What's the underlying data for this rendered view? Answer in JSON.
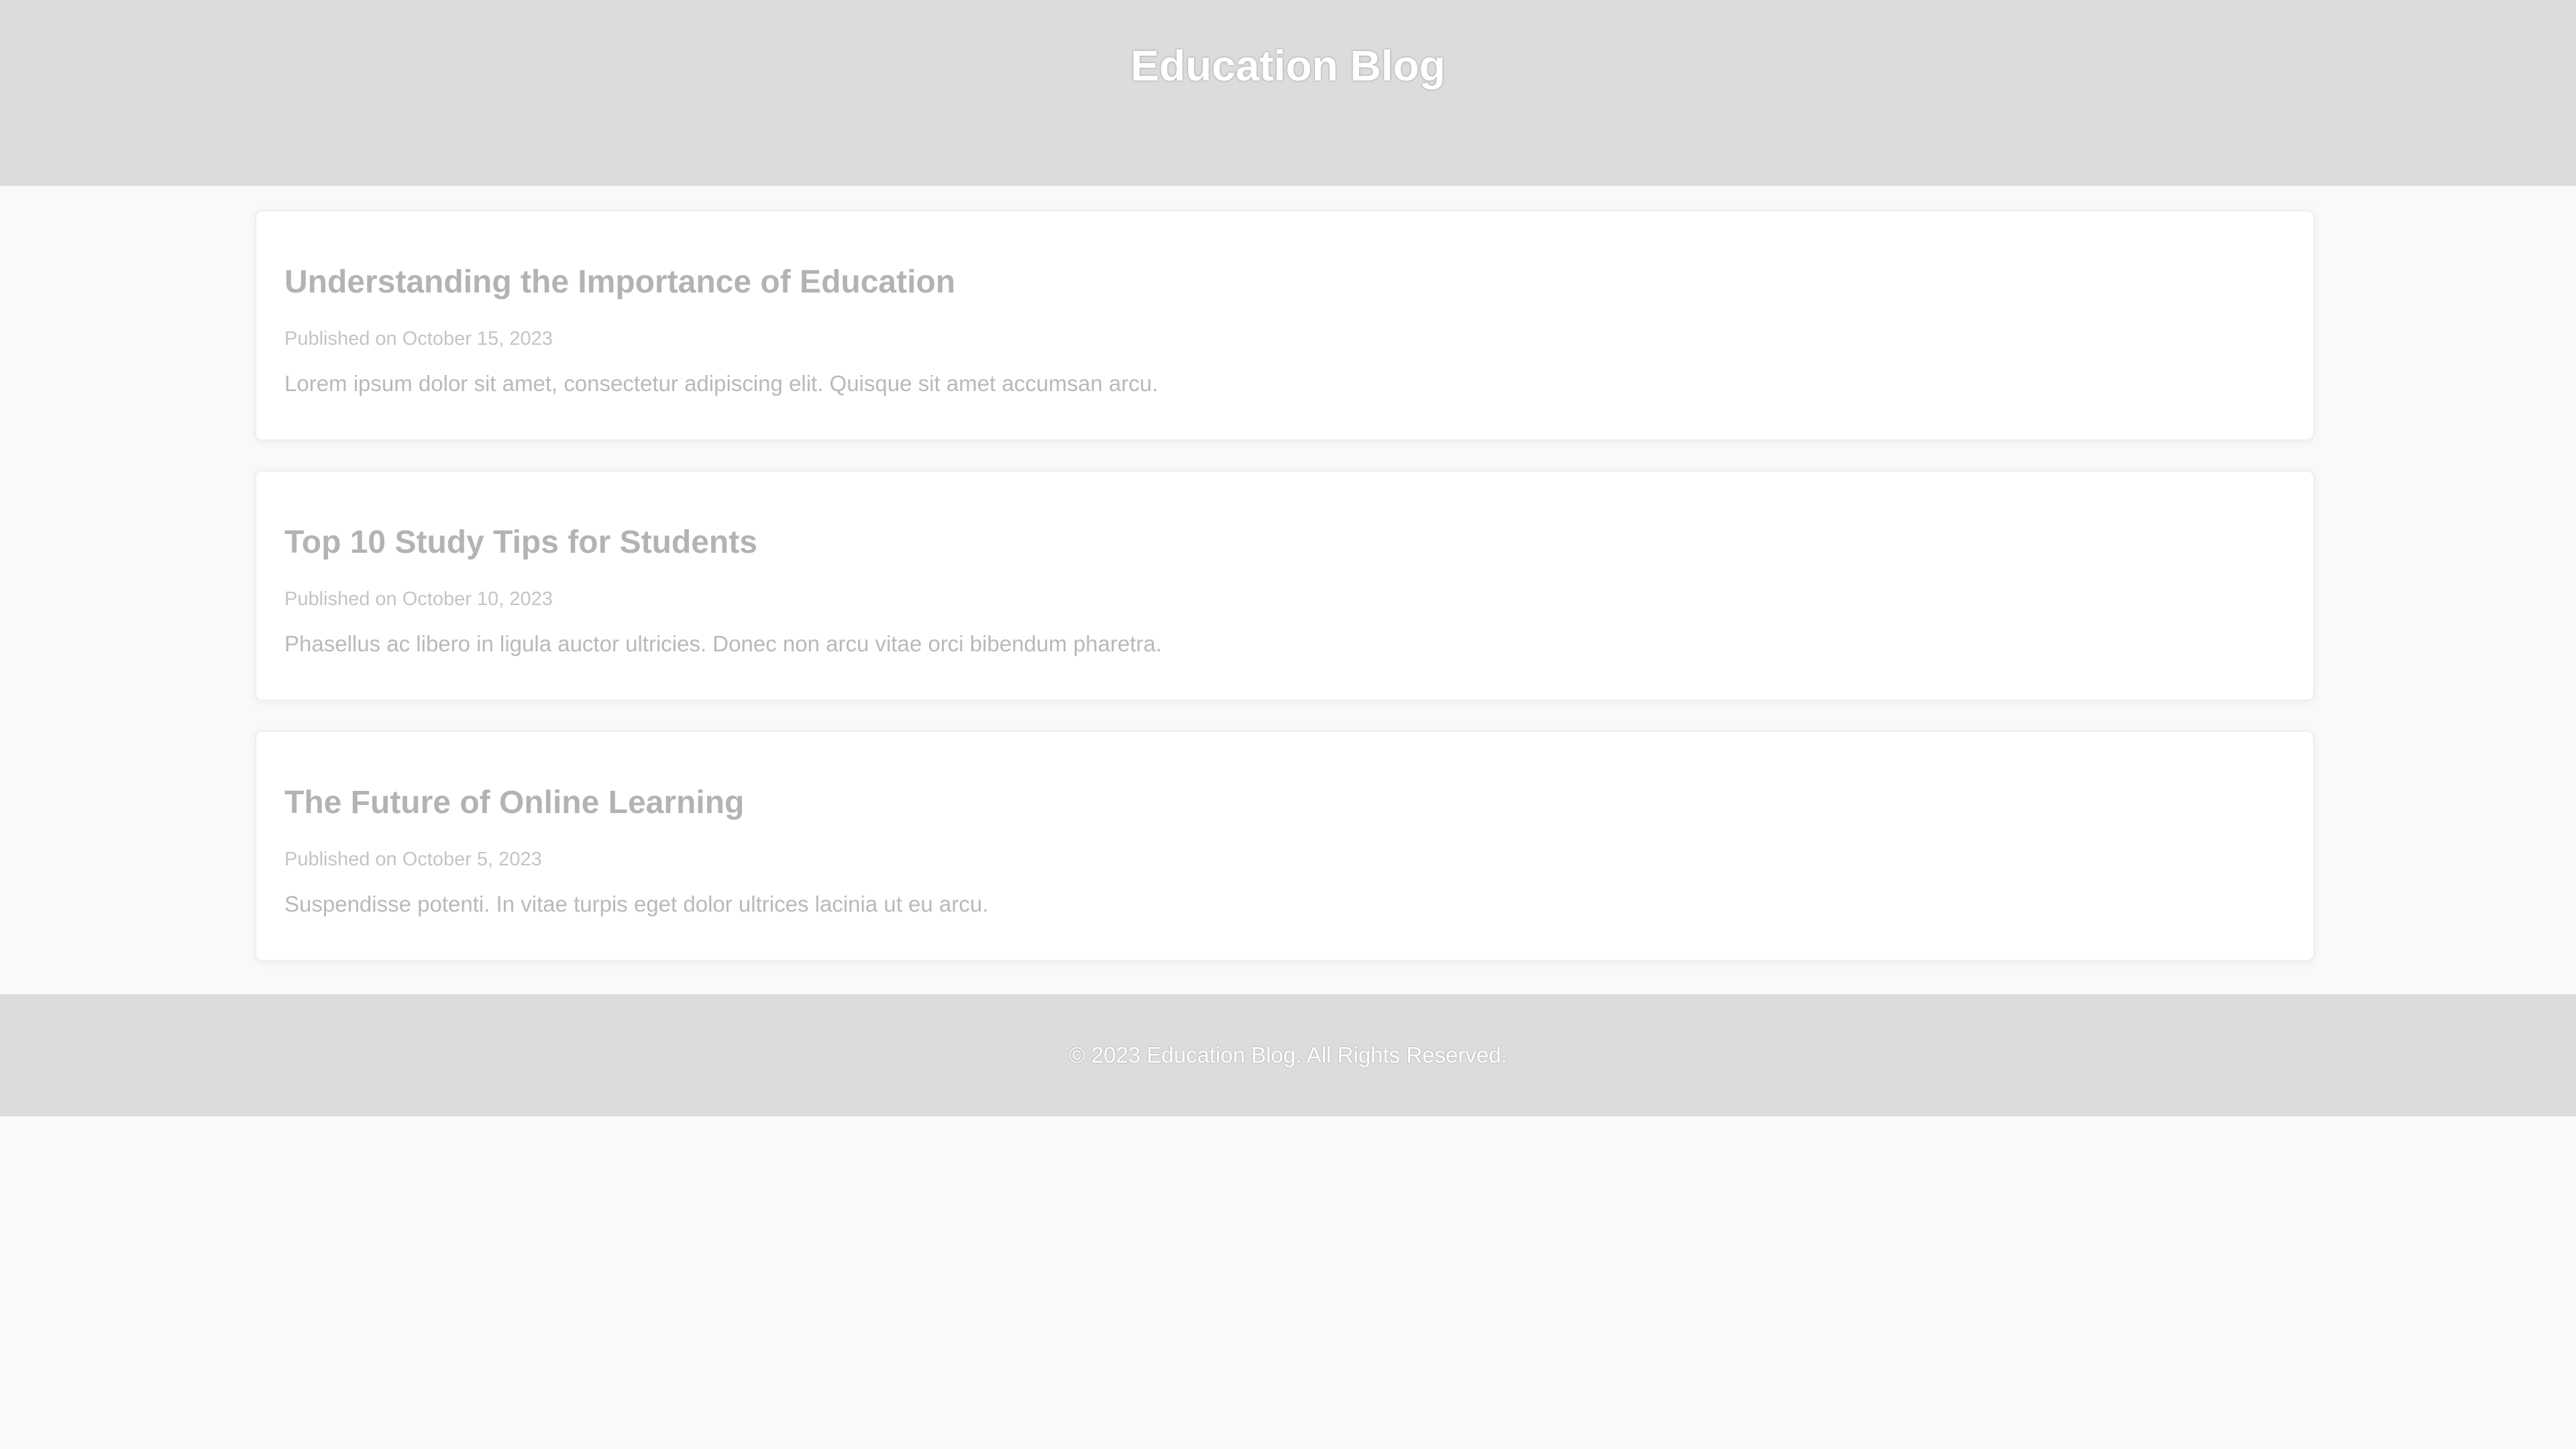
{
  "header": {
    "title": "Education Blog"
  },
  "posts": [
    {
      "title": "Understanding the Importance of Education",
      "date": "Published on October 15, 2023",
      "excerpt": "Lorem ipsum dolor sit amet, consectetur adipiscing elit. Quisque sit amet accumsan arcu."
    },
    {
      "title": "Top 10 Study Tips for Students",
      "date": "Published on October 10, 2023",
      "excerpt": "Phasellus ac libero in ligula auctor ultricies. Donec non arcu vitae orci bibendum pharetra."
    },
    {
      "title": "The Future of Online Learning",
      "date": "Published on October 5, 2023",
      "excerpt": "Suspendisse potenti. In vitae turpis eget dolor ultrices lacinia ut eu arcu."
    }
  ],
  "footer": {
    "copyright": "© 2023 Education Blog. All Rights Reserved."
  },
  "colors": {
    "header_bg": "#dcdcdc",
    "page_bg": "#f9f9f9",
    "card_bg": "#ffffff"
  }
}
